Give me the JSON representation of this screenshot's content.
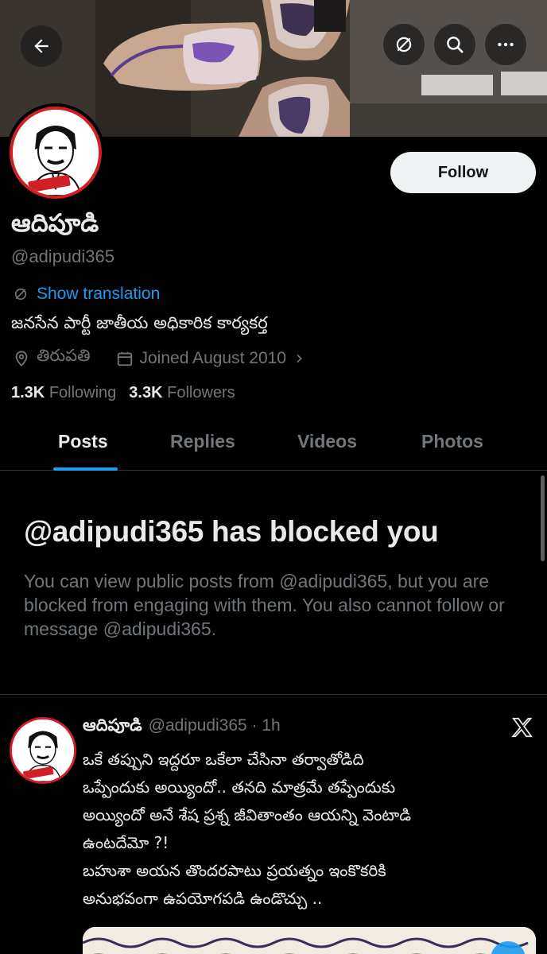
{
  "header": {
    "back_icon": "back-arrow-icon",
    "translate_icon": "translate-slash-icon",
    "search_icon": "search-icon",
    "more_icon": "more-icon"
  },
  "profile": {
    "follow_label": "Follow",
    "display_name": "ఆదిపూడి",
    "handle": "@adipudi365",
    "show_translation": "Show translation",
    "bio": "జనసేన పార్టీ జాతీయ అధికారిక కార్యకర్త",
    "location": "తిరుపతి",
    "joined": "Joined August 2010",
    "following_count": "1.3K",
    "following_label": "Following",
    "followers_count": "3.3K",
    "followers_label": "Followers"
  },
  "tabs": [
    {
      "label": "Posts",
      "active": true
    },
    {
      "label": "Replies",
      "active": false
    },
    {
      "label": "Videos",
      "active": false
    },
    {
      "label": "Photos",
      "active": false
    }
  ],
  "blocked": {
    "title": "@adipudi365 has blocked you",
    "message": "You can view public posts from @adipudi365, but you are blocked from engaging with them. You also cannot follow or message @adipudi365."
  },
  "tweet": {
    "name": "ఆదిపూడి",
    "handle_time": "@adipudi365 · 1h",
    "lines": [
      "ఒకే తప్పుని ఇద్దరూ ఒకేలా చేసినా తర్వాతోడిది",
      "ఒప్పేందుకు అయ్యిందో.. తనది మాత్రమే తప్పేందుకు",
      "అయ్యిందో అనే శేష ప్రశ్న జీవితాంతం ఆయన్ని వెంటాడి",
      "ఉంటదేమో ?!",
      "బహుశా అయన తొందరపాటు ప్రయత్నం ఇంకొకరికి",
      "అనుభవంగా ఉపయోగపడి ఉండొచ్చు .."
    ]
  },
  "colors": {
    "accent": "#1d9bf0",
    "muted": "#71767b",
    "text": "#e7e9ea",
    "background": "#000000",
    "avatar_border": "#d21f26"
  }
}
